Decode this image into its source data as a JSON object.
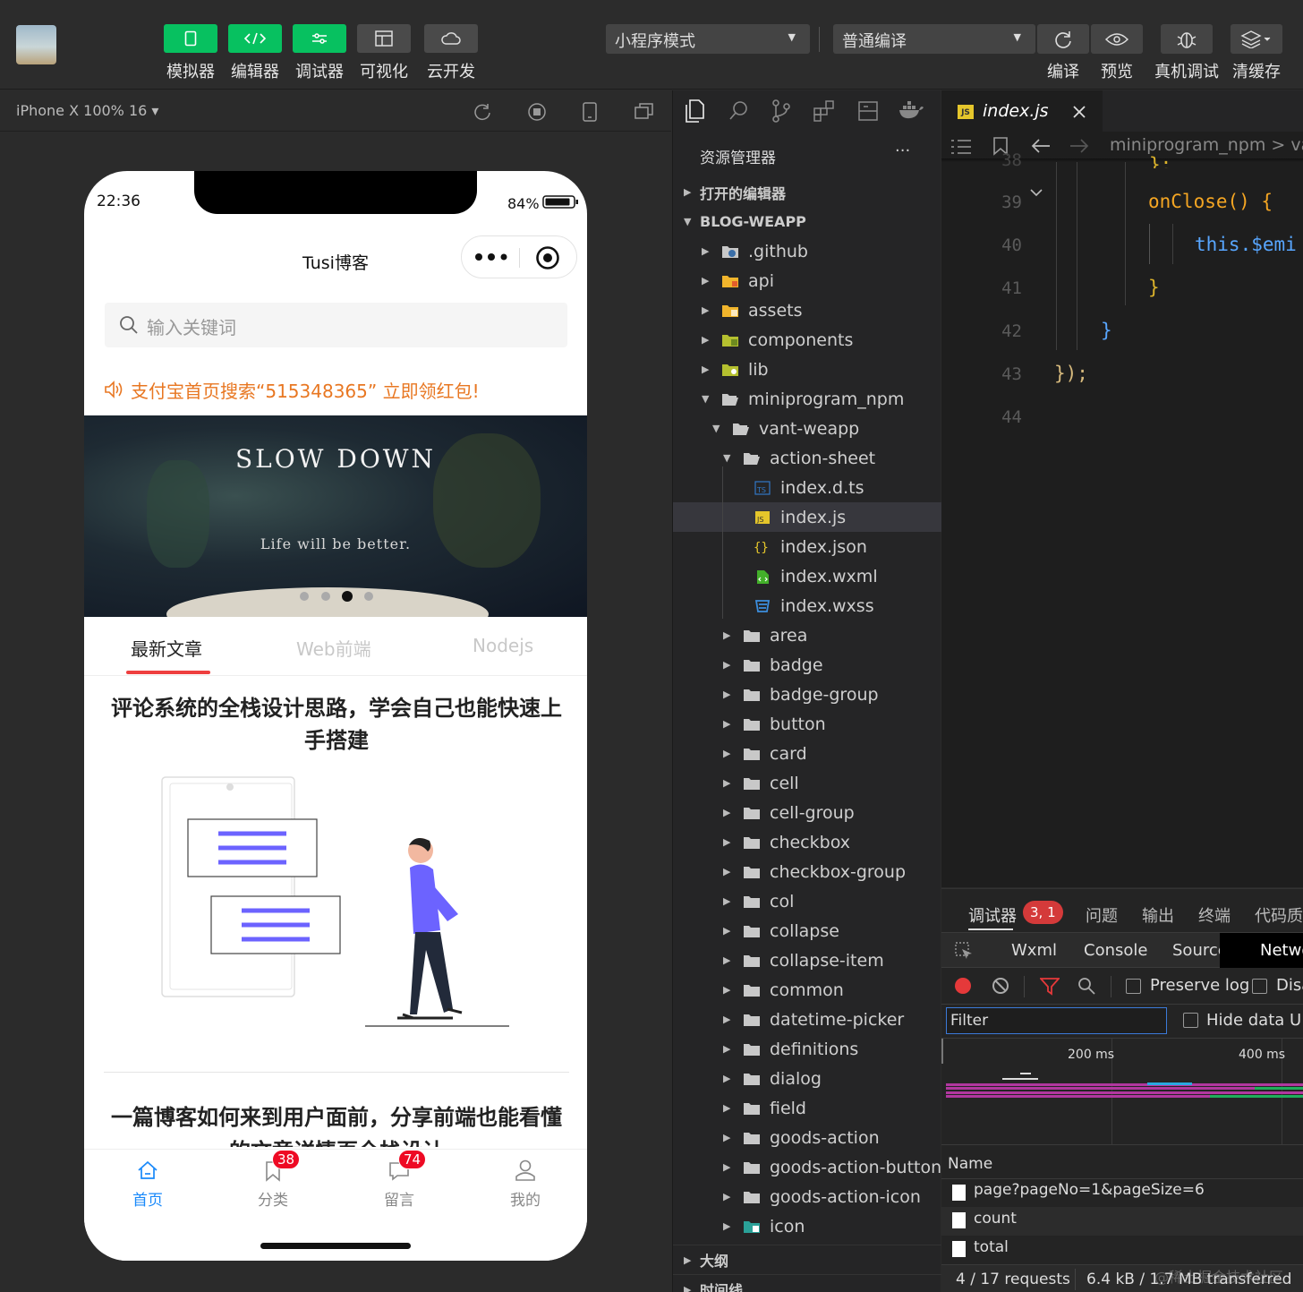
{
  "toolbar": {
    "buttons": [
      {
        "label": "模拟器"
      },
      {
        "label": "编辑器"
      },
      {
        "label": "调试器"
      },
      {
        "label": "可视化"
      },
      {
        "label": "云开发"
      }
    ],
    "mode_select": "小程序模式",
    "compile_select": "普通编译",
    "right_buttons": [
      {
        "label": "编译"
      },
      {
        "label": "预览"
      },
      {
        "label": "真机调试"
      },
      {
        "label": "清缓存"
      }
    ]
  },
  "simulator": {
    "device_label": "iPhone X 100% 16 ▾"
  },
  "phone": {
    "time": "22:36",
    "battery": "84%",
    "title": "Tusi博客",
    "search_placeholder": "输入关键词",
    "notice": "支付宝首页搜索“515348365” 立即领红包!",
    "banner_title": "SLOW DOWN",
    "banner_sub": "Life will be better.",
    "tabs": [
      "最新文章",
      "Web前端",
      "Nodejs"
    ],
    "articles": [
      {
        "title": "评论系统的全栈设计思路，学会自己也能快速上手搭建"
      },
      {
        "title": "一篇博客如何来到用户面前，分享前端也能看懂的文章详情页全栈设计"
      }
    ],
    "tabbar": [
      {
        "label": "首页",
        "badge": ""
      },
      {
        "label": "分类",
        "badge": "38"
      },
      {
        "label": "留言",
        "badge": "74"
      },
      {
        "label": "我的",
        "badge": ""
      }
    ]
  },
  "explorer": {
    "title": "资源管理器",
    "more": "···",
    "open_editors": "打开的编辑器",
    "project": "BLOG-WEAPP",
    "outline": "大纲",
    "timeline": "时间线",
    "items": [
      {
        "label": ".github"
      },
      {
        "label": "api"
      },
      {
        "label": "assets"
      },
      {
        "label": "components"
      },
      {
        "label": "lib"
      },
      {
        "label": "miniprogram_npm"
      },
      {
        "label": "vant-weapp"
      },
      {
        "label": "action-sheet"
      },
      {
        "label": "index.d.ts"
      },
      {
        "label": "index.js"
      },
      {
        "label": "index.json"
      },
      {
        "label": "index.wxml"
      },
      {
        "label": "index.wxss"
      },
      {
        "label": "area"
      },
      {
        "label": "badge"
      },
      {
        "label": "badge-group"
      },
      {
        "label": "button"
      },
      {
        "label": "card"
      },
      {
        "label": "cell"
      },
      {
        "label": "cell-group"
      },
      {
        "label": "checkbox"
      },
      {
        "label": "checkbox-group"
      },
      {
        "label": "col"
      },
      {
        "label": "collapse"
      },
      {
        "label": "collapse-item"
      },
      {
        "label": "common"
      },
      {
        "label": "datetime-picker"
      },
      {
        "label": "definitions"
      },
      {
        "label": "dialog"
      },
      {
        "label": "field"
      },
      {
        "label": "goods-action"
      },
      {
        "label": "goods-action-button"
      },
      {
        "label": "goods-action-icon"
      },
      {
        "label": "icon"
      }
    ]
  },
  "editor": {
    "tab": "index.js",
    "breadcrumb": "miniprogram_npm > vant",
    "line_numbers": [
      "39",
      "40",
      "41",
      "42",
      "43",
      "44"
    ],
    "code": {
      "l38": "};",
      "l39": "onClose() {",
      "l40": "this.$emi",
      "l41": "}",
      "l42": "}",
      "l43": "});"
    }
  },
  "devtools": {
    "panel_tabs": [
      "调试器",
      "问题",
      "输出",
      "终端",
      "代码质"
    ],
    "error_badge": "3, 1",
    "sub_tabs": [
      "Wxml",
      "Console",
      "Sources",
      "Netwo"
    ],
    "preserve_log": "Preserve log",
    "disable_cache": "Disa",
    "filter_placeholder": "Filter",
    "hide_data_urls": "Hide data UR",
    "timeline_labels": [
      "200 ms",
      "400 ms"
    ],
    "name_header": "Name",
    "requests": [
      "page?pageNo=1&pageSize=6",
      "count",
      "total"
    ],
    "summary_requests": "4 / 17 requests",
    "summary_transfer": "6.4 kB / 1.7 MB transferred",
    "watermark": "@稀土掘金技术社区"
  }
}
